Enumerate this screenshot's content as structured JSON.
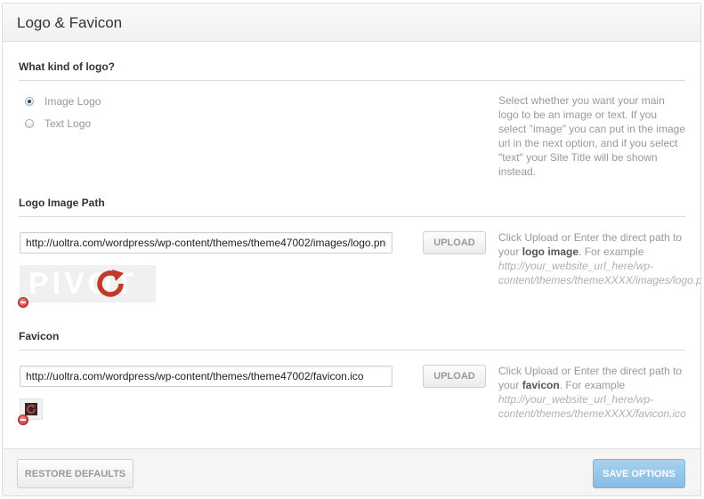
{
  "panel": {
    "title": "Logo & Favicon"
  },
  "logo_type": {
    "title": "What kind of logo?",
    "options": [
      {
        "label": "Image Logo",
        "checked": true
      },
      {
        "label": "Text Logo",
        "checked": false
      }
    ],
    "description": "Select whether you want your main logo to be an image or text. If you select \"image\" you can put in the image url in the next option, and if you select \"text\" your Site Title will be shown instead."
  },
  "logo_image": {
    "title": "Logo Image Path",
    "value": "http://uoltra.com/wordpress/wp-content/themes/theme47002/images/logo.png",
    "upload_label": "UPLOAD",
    "desc_prefix": "Click Upload or Enter the direct path to your ",
    "desc_strong": "logo image",
    "desc_suffix": ". For example",
    "desc_path": "http://your_website_url_here/wp-content/themes/themeXXXX/images/logo.png",
    "preview_ghost_text": "PIVOT"
  },
  "favicon": {
    "title": "Favicon",
    "value": "http://uoltra.com/wordpress/wp-content/themes/theme47002/favicon.ico",
    "upload_label": "UPLOAD",
    "desc_prefix": "Click Upload or Enter the direct path to your ",
    "desc_strong": "favicon",
    "desc_suffix": ". For example",
    "desc_path": "http://your_website_url_here/wp-content/themes/themeXXXX/favicon.ico"
  },
  "footer": {
    "restore_label": "RESTORE DEFAULTS",
    "save_label": "SAVE OPTIONS"
  },
  "colors": {
    "accent_blue": "#86bde5",
    "refresh_red": "#c0392b",
    "remove_red": "#c23030"
  },
  "icons": {
    "logo_preview": "refresh-icon",
    "favicon_preview": "refresh-icon",
    "remove": "remove-icon"
  }
}
